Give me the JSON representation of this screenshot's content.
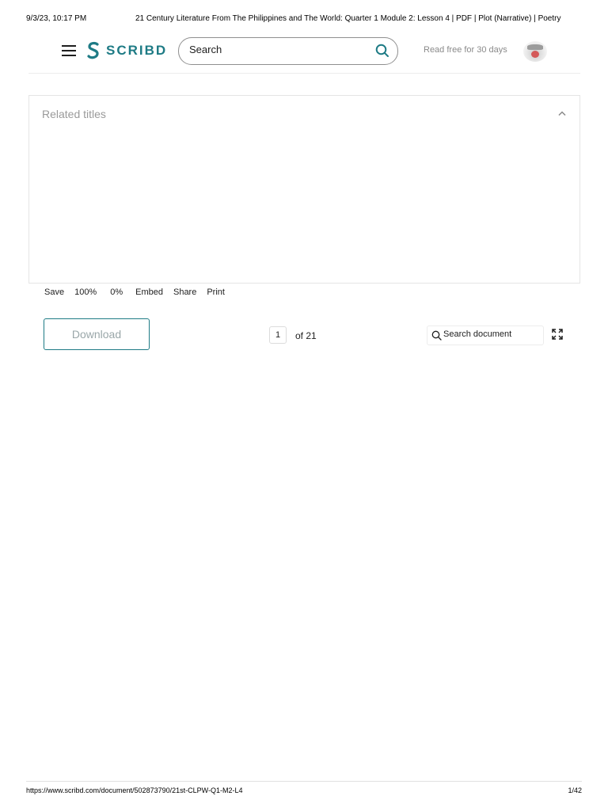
{
  "print_header": {
    "datetime": "9/3/23, 10:17 PM",
    "title": "21 Century Literature From The Philippines and The World: Quarter 1 Module 2: Lesson 4 | PDF | Plot (Narrative) | Poetry"
  },
  "header": {
    "menu_icon": "hamburger-menu-icon",
    "logo_text": "SCRIBD",
    "logo_color": "#1e7b85",
    "search": {
      "placeholder": "Search",
      "value": "",
      "icon": "search-icon"
    },
    "read_free_label": "Read free for 30 days",
    "avatar_icon": "avatar"
  },
  "related": {
    "title": "Related titles",
    "icon": "chevron-up-icon"
  },
  "toolbar": {
    "save_label": "Save",
    "zoom_label": "100%",
    "percent_label": "0%",
    "embed_label": "Embed",
    "share_label": "Share",
    "print_label": "Print"
  },
  "doc_controls": {
    "download_label": "Download",
    "current_page": "1",
    "page_total_label": "of 21",
    "search_placeholder": "Search document",
    "fullscreen_icon": "fullscreen-icon"
  },
  "print_footer": {
    "url": "https://www.scribd.com/document/502873790/21st-CLPW-Q1-M2-L4",
    "page": "1/42"
  }
}
